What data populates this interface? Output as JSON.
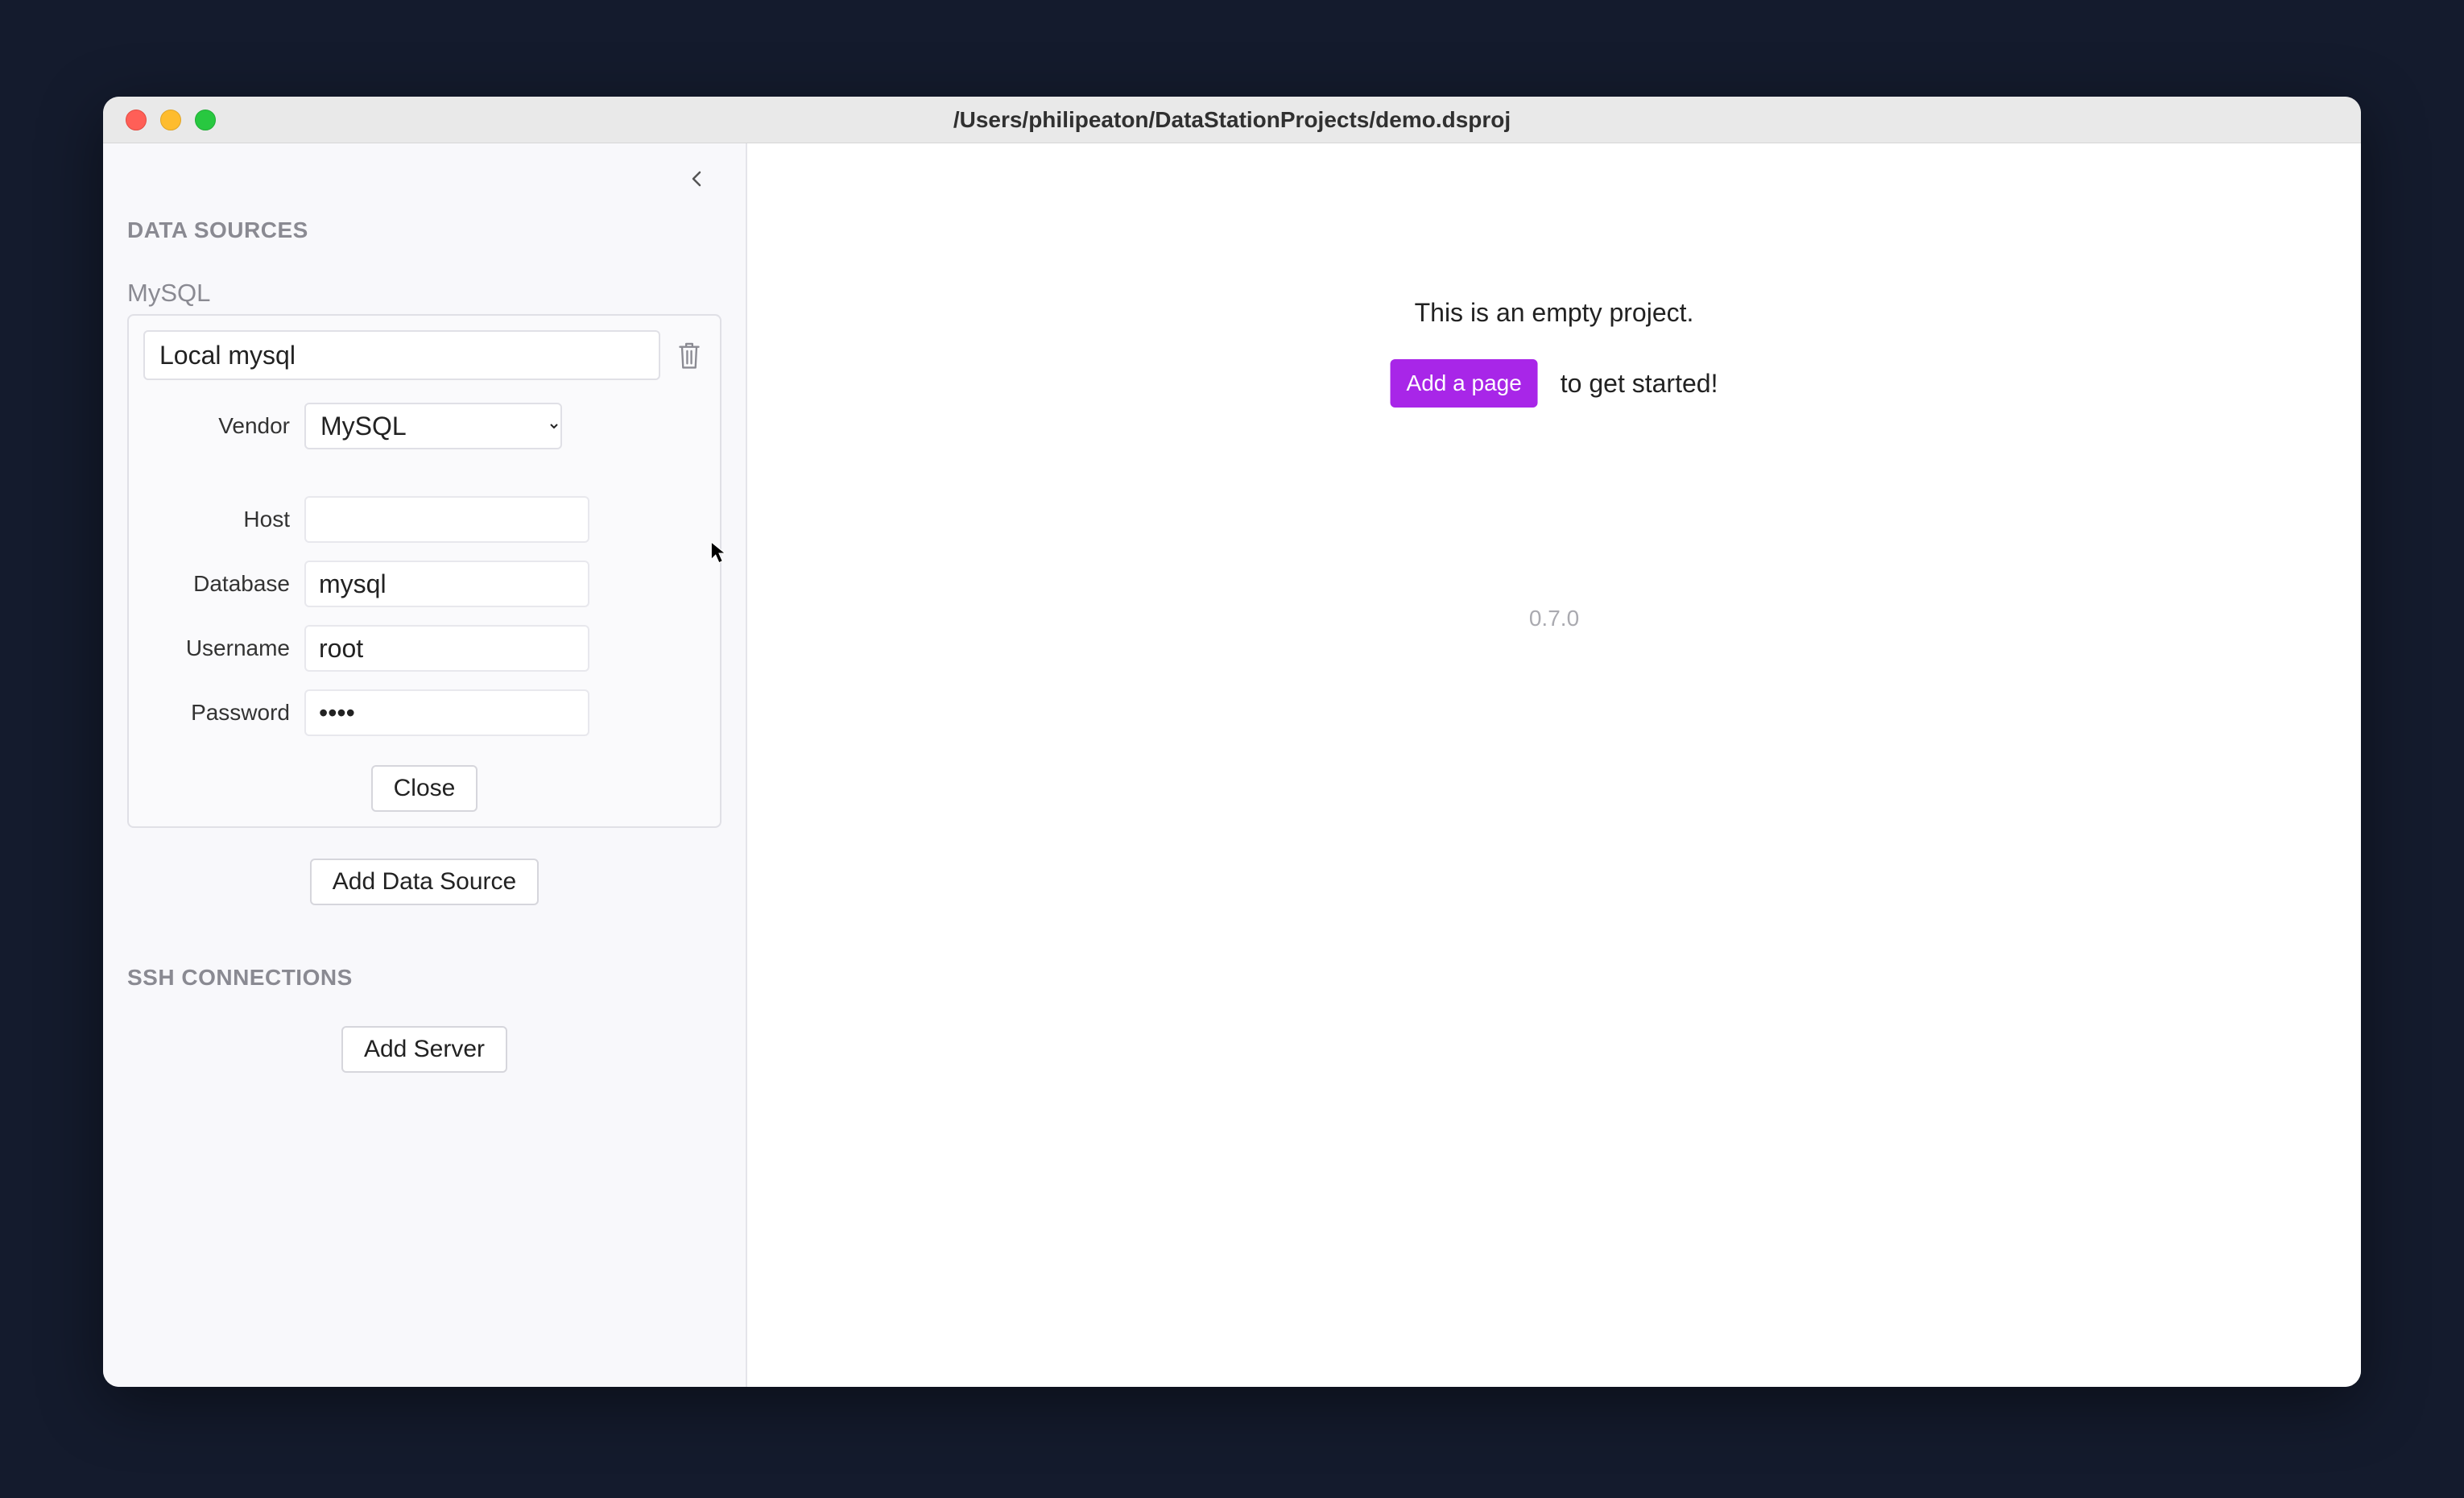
{
  "window": {
    "title": "/Users/philipeaton/DataStationProjects/demo.dsproj"
  },
  "sidebar": {
    "data_sources_header": "DATA SOURCES",
    "source": {
      "type_label": "MySQL",
      "name_value": "Local mysql",
      "vendor_label": "Vendor",
      "vendor_value": "MySQL",
      "host_label": "Host",
      "host_value": "",
      "database_label": "Database",
      "database_value": "mysql",
      "username_label": "Username",
      "username_value": "root",
      "password_label": "Password",
      "password_value": "••••",
      "close_label": "Close"
    },
    "add_data_source_label": "Add Data Source",
    "ssh_header": "SSH CONNECTIONS",
    "add_server_label": "Add Server"
  },
  "main": {
    "empty_message": "This is an empty project.",
    "add_page_label": "Add a page",
    "get_started_text": "to get started!",
    "version": "0.7.0"
  }
}
